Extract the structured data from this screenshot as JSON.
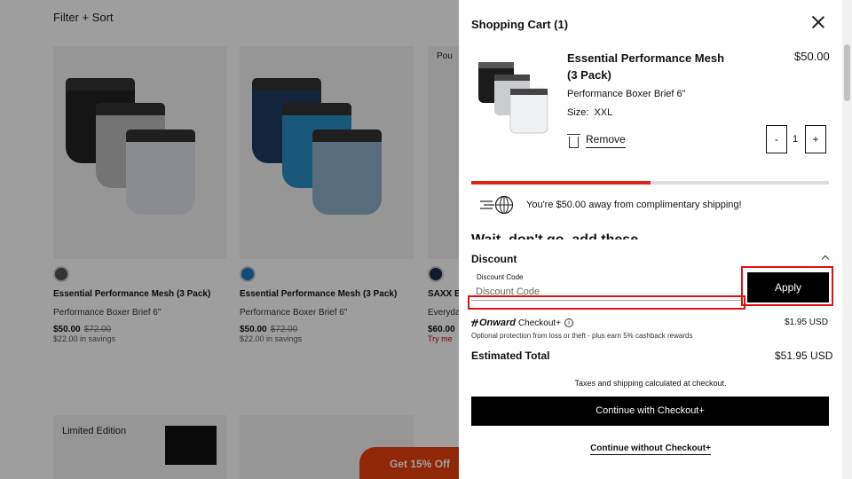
{
  "background": {
    "filter_label": "Filter + Sort",
    "products": [
      {
        "title": "Essential Performance Mesh (3 Pack)",
        "subtitle": "Performance Boxer Brief 6\"",
        "price": "$50.00",
        "compare_price": "$72.00",
        "savings": "$22.00 in savings"
      },
      {
        "title": "Essential Performance Mesh (3 Pack)",
        "subtitle": "Performance Boxer Brief 6\"",
        "price": "$50.00",
        "compare_price": "$72.00",
        "savings": "$22.00 in savings"
      },
      {
        "title": "SAXX Ess",
        "subtitle": "Everyda",
        "price": "$60.00",
        "compare_price": "",
        "savings": "Try me"
      }
    ],
    "limited_label": "Limited Edition",
    "promo_label": "Get 15% Off",
    "peek_label": "Pou"
  },
  "cart": {
    "title": "Shopping Cart (1)",
    "item": {
      "name": "Essential Performance Mesh (3 Pack)",
      "price": "$50.00",
      "variant": "Performance Boxer Brief 6\"",
      "size_label": "Size:",
      "size_value": "XXL",
      "remove_label": "Remove",
      "quantity": "1",
      "minus": "-",
      "plus": "+"
    },
    "shipping_progress": 0.5,
    "shipping_message": "You're $50.00 away from complimentary shipping!",
    "peek_heading": "Wait, don't go, add these"
  },
  "discount": {
    "title": "Discount",
    "code_label": "Discount Code",
    "code_placeholder": "Discount Code",
    "apply_label": "Apply"
  },
  "onward": {
    "brand": "Onward",
    "label": "Checkout+",
    "info": "i",
    "price": "$1.95 USD",
    "description": "Optional protection from loss or theft - plus earn 5% cashback rewards"
  },
  "totals": {
    "label": "Estimated Total",
    "value": "$51.95 USD",
    "taxes_note": "Taxes and shipping calculated at checkout."
  },
  "actions": {
    "checkout_label": "Continue with Checkout+",
    "continue_label": "Continue without Checkout+"
  },
  "colors": {
    "accent_red": "#e0241a",
    "highlight_red": "#e01010",
    "button_black": "#000000"
  }
}
